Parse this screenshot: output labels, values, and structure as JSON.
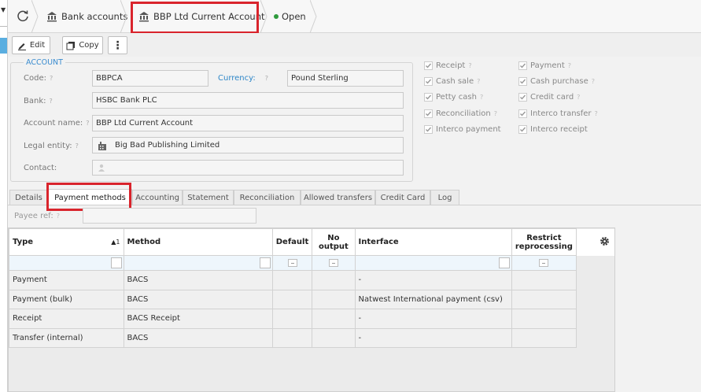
{
  "breadcrumb": {
    "bank_accounts": "Bank accounts",
    "current": "BBP Ltd Current Account",
    "status": "Open"
  },
  "toolbar": {
    "edit": "Edit",
    "copy": "Copy"
  },
  "account": {
    "legend": "ACCOUNT",
    "code_label": "Code:",
    "code_value": "BBPCA",
    "currency_label": "Currency:",
    "currency_value": "Pound Sterling",
    "bank_label": "Bank:",
    "bank_value": "HSBC Bank PLC",
    "name_label": "Account name:",
    "name_value": "BBP Ltd Current Account",
    "entity_label": "Legal entity:",
    "entity_value": "Big Bad Publishing Limited",
    "contact_label": "Contact:",
    "contact_value": ""
  },
  "checkboxes": {
    "receipt": "Receipt",
    "payment": "Payment",
    "cash_sale": "Cash sale",
    "cash_purchase": "Cash purchase",
    "petty_cash": "Petty cash",
    "credit_card": "Credit card",
    "reconciliation": "Reconciliation",
    "interco_transfer": "Interco transfer",
    "interco_payment": "Interco payment",
    "interco_receipt": "Interco receipt"
  },
  "tabs": [
    "Details",
    "Payment methods",
    "Accounting",
    "Statement",
    "Reconciliation",
    "Allowed transfers",
    "Credit Card",
    "Log"
  ],
  "payee_ref_label": "Payee ref:",
  "grid": {
    "headers": {
      "type": "Type",
      "sort": "▲1",
      "method": "Method",
      "default": "Default",
      "no_output": "No output",
      "interface": "Interface",
      "restrict": "Restrict reprocessing"
    },
    "rows": [
      {
        "type": "Payment",
        "method": "BACS",
        "interface": "-"
      },
      {
        "type": "Payment (bulk)",
        "method": "BACS",
        "interface": "Natwest International payment (csv)"
      },
      {
        "type": "Receipt",
        "method": "BACS Receipt",
        "interface": "-"
      },
      {
        "type": "Transfer (internal)",
        "method": "BACS",
        "interface": "-"
      }
    ]
  },
  "colors": {
    "highlight": "#d9242c",
    "accent": "#3a8ccf",
    "status": "#2e9a3c"
  }
}
